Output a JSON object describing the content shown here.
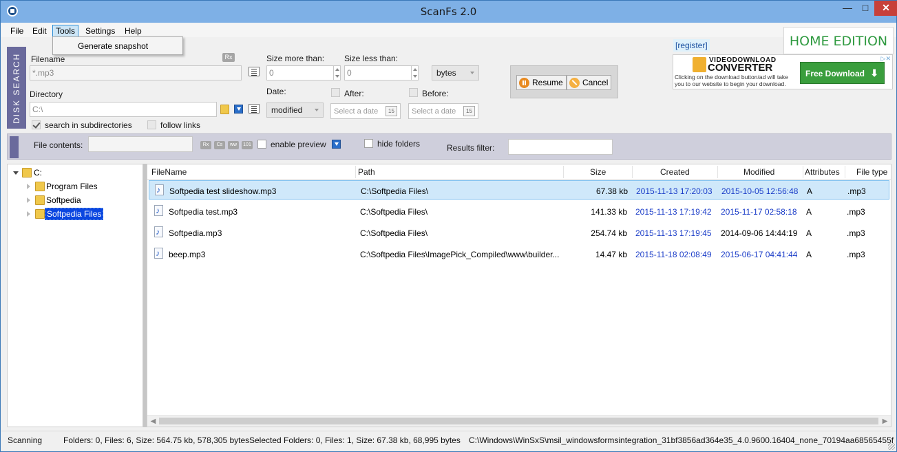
{
  "window": {
    "title": "ScanFs 2.0"
  },
  "menu": {
    "items": [
      "File",
      "Edit",
      "Tools",
      "Settings",
      "Help"
    ],
    "open_dropdown": {
      "parent": "Tools",
      "items": [
        "Generate snapshot"
      ]
    }
  },
  "search": {
    "side_tab_label": "DISK SEARCH",
    "filename_label": "Filename",
    "filename_value": "*.mp3",
    "regex_label": "Rx",
    "directory_label": "Directory",
    "directory_value": "C:\\",
    "search_subdirs_label": "search in subdirectories",
    "search_subdirs_checked": true,
    "follow_links_label": "follow links",
    "follow_links_checked": false,
    "size_more_label": "Size more than:",
    "size_more_value": "0",
    "size_less_label": "Size less than:",
    "size_less_value": "0",
    "size_unit": "bytes",
    "date_label": "Date:",
    "date_mode": "modified",
    "after_label": "After:",
    "before_label": "Before:",
    "date_placeholder": "Select a date",
    "calendar_label": "15"
  },
  "actions": {
    "resume_label": "Resume",
    "cancel_label": "Cancel"
  },
  "branding": {
    "register_label": "[register]",
    "edition_label": "HOME EDITION",
    "ad": {
      "title_small": "VIDEODOWNLOAD",
      "title_big": "CONVERTER",
      "text": "Clicking on the download button/ad will take you to our website to begin your download.",
      "button_label": "Free Download"
    }
  },
  "contents": {
    "label": "File contents:",
    "option_buttons": [
      "Rx",
      "Cs",
      "ww",
      "101"
    ],
    "enable_preview_label": "enable preview",
    "hide_folders_label": "hide folders",
    "results_filter_label": "Results filter:"
  },
  "tree": {
    "root": "C:",
    "children": [
      "Program Files",
      "Softpedia",
      "Softpedia Files"
    ],
    "selected": "Softpedia Files"
  },
  "grid": {
    "columns": [
      "FileName",
      "Path",
      "Size",
      "Created",
      "Modified",
      "Attributes",
      "File type"
    ],
    "rows": [
      {
        "name": "Softpedia test slideshow.mp3",
        "path": "C:\\Softpedia Files\\",
        "size": "67.38 kb",
        "created": "2015-11-13 17:20:03",
        "modified": "2015-10-05 12:56:48",
        "attributes": "A",
        "type": ".mp3"
      },
      {
        "name": "Softpedia test.mp3",
        "path": "C:\\Softpedia Files\\",
        "size": "141.33 kb",
        "created": "2015-11-13 17:19:42",
        "modified": "2015-11-17 02:58:18",
        "attributes": "A",
        "type": ".mp3"
      },
      {
        "name": "Softpedia.mp3",
        "path": "C:\\Softpedia Files\\",
        "size": "254.74 kb",
        "created": "2015-11-13 17:19:45",
        "modified": "2014-09-06 14:44:19",
        "attributes": "A",
        "type": ".mp3"
      },
      {
        "name": "beep.mp3",
        "path": "C:\\Softpedia Files\\ImagePick_Compiled\\www\\builder...",
        "size": "14.47 kb",
        "created": "2015-11-18 02:08:49",
        "modified": "2015-06-17 04:41:44",
        "attributes": "A",
        "type": ".mp3"
      }
    ]
  },
  "status": {
    "state": "Scanning",
    "totals": "Folders: 0, Files: 6, Size: 564.75 kb, 578,305 bytes",
    "selected": "Selected Folders: 0, Files: 1, Size: 67.38 kb, 68,995 bytes",
    "current_path": "C:\\Windows\\WinSxS\\msil_windowsformsintegration_31bf3856ad364e35_4.0.9600.16404_none_70194aa68565455f"
  },
  "colors": {
    "title_bar": "#7eb0e6",
    "accent_tab": "#6a6a9c",
    "selection": "#cfe8fa",
    "date_text": "#1a3cc8",
    "edition_green": "#2f9a40"
  }
}
